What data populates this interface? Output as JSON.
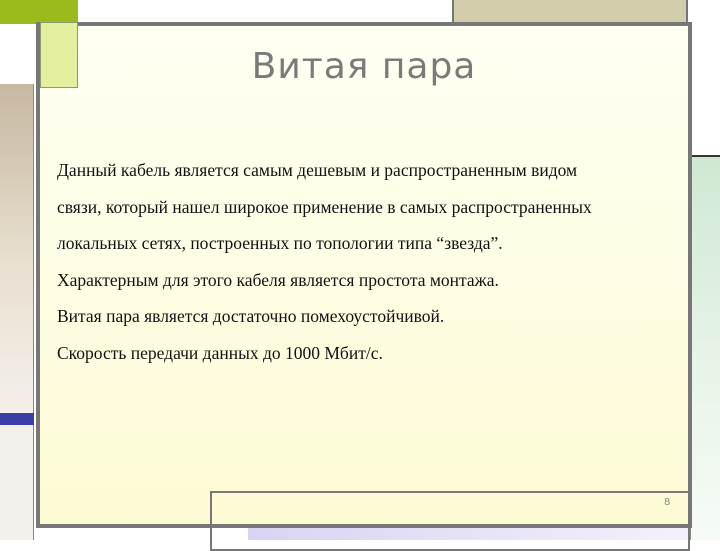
{
  "slide": {
    "title": "Витая пара",
    "lines": [
      "Данный кабель является самым дешевым и распространенным видом",
      "связи, который нашел широкое применение в самых распространенных",
      "локальных сетях, построенных по топологии типа “звезда”.",
      "Характерным для этого кабеля является простота монтажа.",
      "Витая пара является достаточно помехоустойчивой.",
      "Скорость передачи данных до 1000 Мбит/с."
    ],
    "page_number": "8"
  },
  "colors": {
    "accent_green": "#9bbb1c",
    "frame_grey": "#777777",
    "title_grey": "#7a7a7a",
    "strip_blue": "#3a3fa6"
  }
}
